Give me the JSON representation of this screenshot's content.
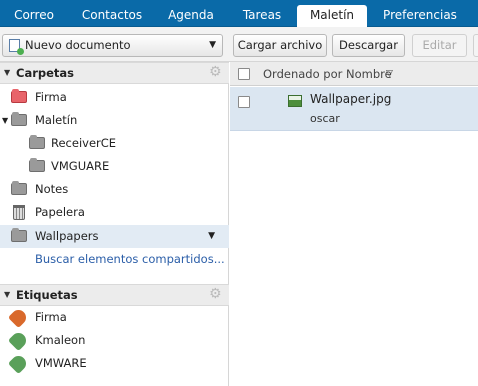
{
  "tabs": [
    {
      "label": "Correo",
      "active": false
    },
    {
      "label": "Contactos",
      "active": false
    },
    {
      "label": "Agenda",
      "active": false
    },
    {
      "label": "Tareas",
      "active": false
    },
    {
      "label": "Maletín",
      "active": true
    },
    {
      "label": "Preferencias",
      "active": false
    }
  ],
  "toolbar": {
    "new_document": "Nuevo documento",
    "upload": "Cargar archivo",
    "download": "Descargar",
    "edit": "Editar"
  },
  "sidebar": {
    "folders_title": "Carpetas",
    "folders": [
      {
        "label": "Firma",
        "icon": "red-folder-icon"
      },
      {
        "label": "Maletín",
        "icon": "folder-icon"
      },
      {
        "label": "ReceiverCE",
        "icon": "folder-icon"
      },
      {
        "label": "VMGUARE",
        "icon": "folder-icon"
      },
      {
        "label": "Notes",
        "icon": "folder-icon"
      },
      {
        "label": "Papelera",
        "icon": "trash-icon"
      },
      {
        "label": "Wallpapers",
        "icon": "folder-icon",
        "selected": true
      }
    ],
    "search_shared": "Buscar elementos compartidos...",
    "tags_title": "Etiquetas",
    "tags": [
      {
        "label": "Firma",
        "color": "#d9692b"
      },
      {
        "label": "Kmaleon",
        "color": "#5aa05a"
      },
      {
        "label": "VMWARE",
        "color": "#5aa05a"
      }
    ]
  },
  "list": {
    "sort_label": "Ordenado por Nombre",
    "items": [
      {
        "name": "Wallpaper.jpg",
        "owner": "oscar",
        "icon": "image-file-icon"
      }
    ]
  },
  "colors": {
    "tabbar": "#0a6aa8",
    "selected_row": "#dbe6f1",
    "link": "#2b5ea8"
  }
}
